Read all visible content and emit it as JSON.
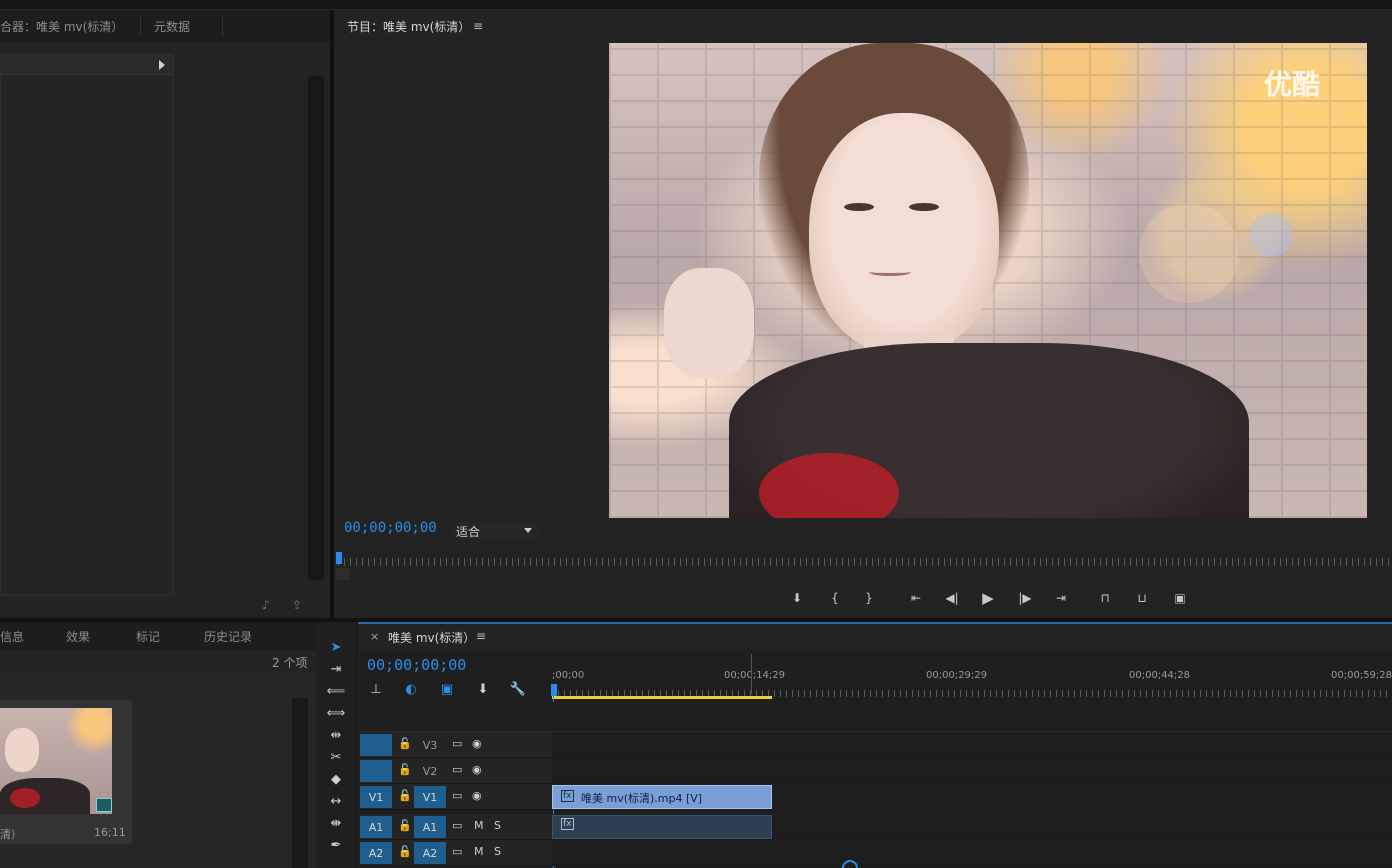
{
  "top_panel": {
    "source_tab": "合器：唯美 mv(标清）",
    "metadata_tab": "元数据"
  },
  "program_monitor": {
    "tab_label": "节目：唯美 mv(标清）",
    "menu_glyph": "≡",
    "timecode": "00;00;00;00",
    "fit_label": "适合",
    "watermark": "优酷",
    "controls": [
      "add-marker",
      "mark-in",
      "mark-out",
      "go-to-in",
      "step-back",
      "play",
      "step-forward",
      "go-to-out",
      "lift",
      "extract",
      "export-frame"
    ]
  },
  "project_panel": {
    "tabs": [
      "信息",
      "效果",
      "标记",
      "历史记录"
    ],
    "item_count": "2 个项",
    "clip_name": "清）",
    "clip_duration": "16;11"
  },
  "timeline": {
    "close_glyph": "×",
    "tab_label": "唯美 mv(标清）",
    "menu_glyph": "≡",
    "timecode": "00;00;00;00",
    "ruler_labels": [
      ";00;00",
      "00;00;14;29",
      "00;00;29;29",
      "00;00;44;28",
      "00;00;59;28"
    ],
    "tracks": [
      {
        "source": "",
        "target": "V3",
        "type": "video"
      },
      {
        "source": "",
        "target": "V2",
        "type": "video"
      },
      {
        "source": "V1",
        "target": "V1",
        "type": "video"
      },
      {
        "source": "A1",
        "target": "A1",
        "type": "audio"
      },
      {
        "source": "A2",
        "target": "A2",
        "type": "audio"
      }
    ],
    "video_clip_label": "唯美 mv(标清).mp4 [V]",
    "fx_label": "fx",
    "mute_label": "M",
    "solo_label": "S"
  },
  "colors": {
    "timecode_blue": "#2d8ceb",
    "video_clip": "#7a9fd6",
    "audio_clip": "#2e3f52",
    "work_area": "#e8d23a",
    "track_target": "#1f5f8f"
  }
}
